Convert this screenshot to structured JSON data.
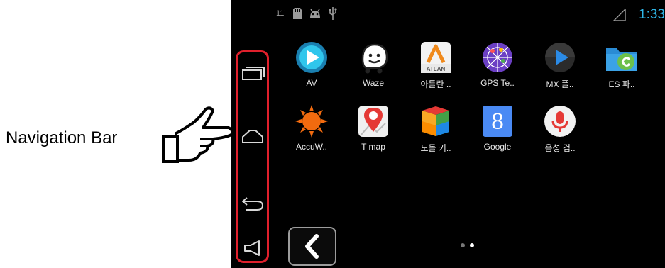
{
  "annotation": {
    "caption": "Navigation Bar",
    "pointer_icon": "pointing-hand-icon",
    "highlight_color": "#e0202c"
  },
  "status_bar": {
    "left_text": "11'",
    "left_icons": [
      "sd-card-icon",
      "android-debug-icon",
      "usb-icon"
    ],
    "signal_icon": "signal-icon",
    "clock": "1:33",
    "clock_color": "#2fb7e8"
  },
  "navigation_bar": {
    "buttons": [
      {
        "name": "recent-apps",
        "icon": "recent-apps-icon"
      },
      {
        "name": "home",
        "icon": "home-icon"
      },
      {
        "name": "back",
        "icon": "back-arrow-icon"
      },
      {
        "name": "volume",
        "icon": "speaker-icon"
      }
    ]
  },
  "apps": [
    {
      "label": "AV",
      "icon": "av-player-icon"
    },
    {
      "label": "Waze",
      "icon": "waze-icon"
    },
    {
      "label": "아틀란 ..",
      "icon": "atlan-icon",
      "icon_text": "ATLAN"
    },
    {
      "label": "GPS Te..",
      "icon": "gps-test-icon"
    },
    {
      "label": "MX 플..",
      "icon": "mx-player-icon"
    },
    {
      "label": "ES 파..",
      "icon": "es-file-icon"
    },
    {
      "label": "AccuW..",
      "icon": "accuweather-icon"
    },
    {
      "label": "T map",
      "icon": "tmap-icon"
    },
    {
      "label": "도돌 키..",
      "icon": "dodol-keyboard-icon"
    },
    {
      "label": "Google",
      "icon": "google-search-icon",
      "icon_text": "8"
    },
    {
      "label": "음성 검..",
      "icon": "voice-search-icon"
    }
  ],
  "footer": {
    "back_key_icon": "chevron-left-icon",
    "page_count": 2,
    "current_page": 2
  }
}
